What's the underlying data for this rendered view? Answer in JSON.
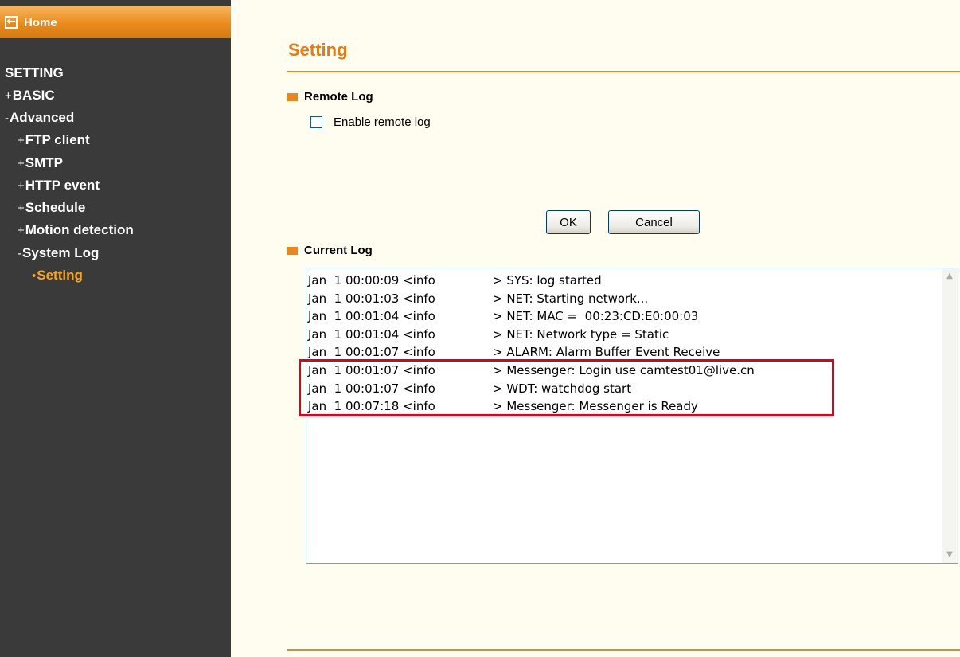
{
  "sidebar": {
    "home_label": "Home",
    "heading": "SETTING",
    "items": [
      {
        "marker": "+",
        "label": "BASIC"
      },
      {
        "marker": "-",
        "label": "Advanced"
      },
      {
        "marker": "+",
        "label": "FTP client"
      },
      {
        "marker": "+",
        "label": "SMTP"
      },
      {
        "marker": "+",
        "label": "HTTP event"
      },
      {
        "marker": "+",
        "label": "Schedule"
      },
      {
        "marker": "+",
        "label": "Motion detection"
      },
      {
        "marker": "-",
        "label": "System Log"
      },
      {
        "marker": "•",
        "label": "Setting"
      }
    ],
    "active_item": "Setting"
  },
  "main": {
    "title": "Setting",
    "remote_log": {
      "heading": "Remote Log",
      "enable_label": "Enable remote log",
      "enabled": false
    },
    "buttons": {
      "ok": "OK",
      "cancel": "Cancel"
    },
    "current_log": {
      "heading": "Current Log",
      "lines": [
        {
          "time": "Jan  1 00:00:09 <info",
          "msg": "> SYS: log started"
        },
        {
          "time": "Jan  1 00:01:03 <info",
          "msg": "> NET: Starting network..."
        },
        {
          "time": "Jan  1 00:01:04 <info",
          "msg": "> NET: MAC =  00:23:CD:E0:00:03"
        },
        {
          "time": "Jan  1 00:01:04 <info",
          "msg": "> NET: Network type = Static"
        },
        {
          "time": "Jan  1 00:01:07 <info",
          "msg": "> ALARM: Alarm Buffer Event Receive"
        },
        {
          "time": "Jan  1 00:01:07 <info",
          "msg": "> Messenger: Login use camtest01@live.cn"
        },
        {
          "time": "Jan  1 00:01:07 <info",
          "msg": "> WDT: watchdog start"
        },
        {
          "time": "Jan  1 00:07:18 <info",
          "msg": "> Messenger: Messenger is Ready"
        }
      ]
    }
  },
  "colors": {
    "accent": "#e07d16",
    "sidebar_bg": "#3a3a3a",
    "highlight": "#e0001a",
    "page_bg": "#fffcf0"
  }
}
